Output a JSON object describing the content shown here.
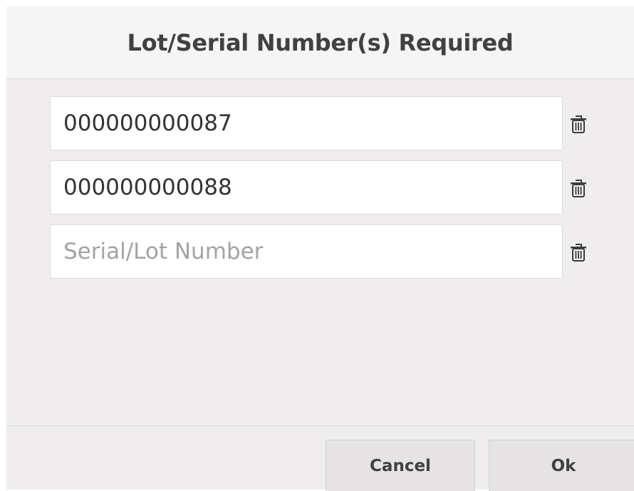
{
  "dialog": {
    "title": "Lot/Serial Number(s) Required"
  },
  "fields": [
    {
      "value": "000000000087",
      "placeholder": "Serial/Lot Number",
      "delete_icon": "trash-icon"
    },
    {
      "value": "000000000088",
      "placeholder": "Serial/Lot Number",
      "delete_icon": "trash-icon"
    },
    {
      "value": "",
      "placeholder": "Serial/Lot Number",
      "delete_icon": "trash-icon"
    }
  ],
  "buttons": {
    "cancel_label": "Cancel",
    "ok_label": "Ok"
  }
}
